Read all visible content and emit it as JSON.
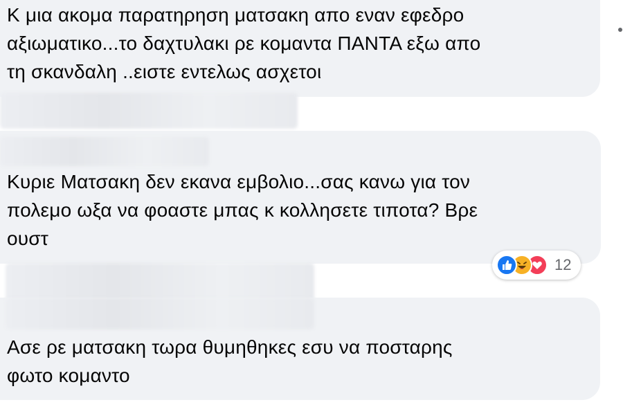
{
  "comments": [
    {
      "author": "",
      "text": "Κ μια ακομα παρατηρηση ματσακη απο εναν εφεδρο\nαξιωματικο...το δαχτυλακι ρε κομαντα ΠΑΝΤΑ εξω απο\nτη σκανδαλη ..ειστε εντελως ασχετοι"
    },
    {
      "author": "",
      "text": "Κυριε Ματσακη δεν εκανα εμβολιο...σας κανω για τον\nπολεμο ωξα να φοαστε μπας κ κολλησετε τιποτα? Βρε\nουστ",
      "reactions": {
        "icons": [
          "like-icon",
          "haha-icon",
          "love-icon"
        ],
        "count": "12"
      }
    },
    {
      "author": "",
      "text": "Ασε ρε ματσακη τωρα θυμηθηκες εσυ να ποσταρης\nφωτο κομαντο"
    }
  ],
  "colors": {
    "bubble": "#f0f2f5",
    "text": "#050505",
    "like": "#1877f2",
    "haha": "#f7b125",
    "love": "#f33e58",
    "muted": "#65676b"
  }
}
